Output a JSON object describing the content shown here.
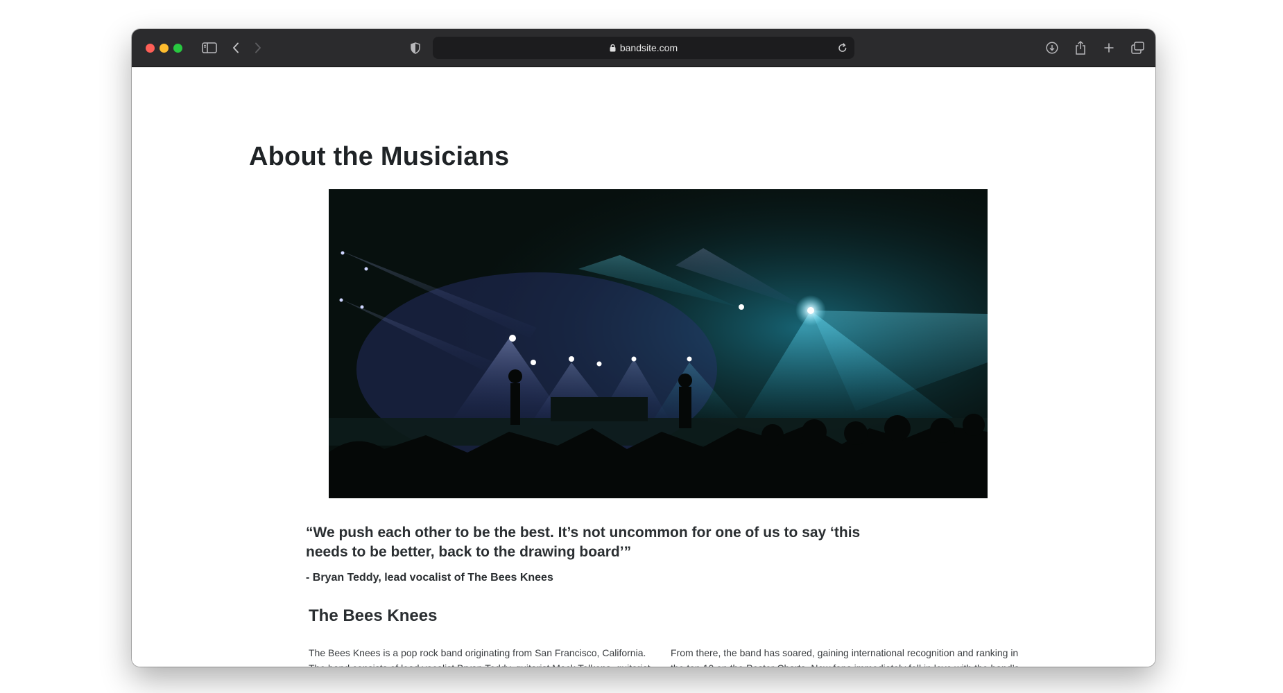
{
  "browser": {
    "url": "bandsite.com",
    "icons": [
      "close-icon",
      "minimize-icon",
      "zoom-icon",
      "sidebar-icon",
      "back-icon",
      "forward-icon",
      "shield-icon",
      "lock-icon",
      "reload-icon",
      "download-icon",
      "share-icon",
      "new-tab-icon",
      "tab-overview-icon"
    ]
  },
  "page": {
    "title": "About the Musicians",
    "hero_image": "concert stage with blue spotlights and crowd silhouettes",
    "quote": "“We push each other to be the best. It’s not uncommon for one of us to say ‘this needs to be better, back to the drawing board’”",
    "attribution": "- Bryan Teddy, lead vocalist of The Bees Knees",
    "band_heading": "The Bees Knees",
    "bio_left": "The Bees Knees is a pop rock band originating from San Francisco, California. The band consists of lead vocalist Bryan Teddy, guitarist Mack Tolkens, guitarist Andrew Green, bassist Kent Zulkee and drummer Freddie Fischer. The band achieved its first commercial success as an unsigned act, drawing attention from",
    "bio_right": "From there, the band has soared, gaining international recognition and ranking in the top 10 on the Poster Charts. New fans immediately fell in love with the band’s original and organic attitude, solidifying their place as one of the hottest and fastest up and coming acts of this century. Fans affectionately refer to"
  },
  "colors": {
    "toolbar": "#2b2b2d",
    "urlbar": "#1c1c1e",
    "close": "#ff5f57",
    "minimize": "#febc2e",
    "zoom": "#28c840",
    "text": "#2a2e31",
    "spotlight": "#37c8e6"
  }
}
